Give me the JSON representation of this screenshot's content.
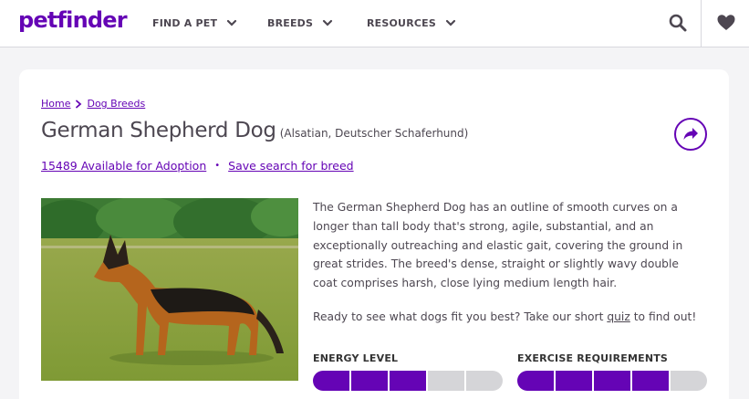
{
  "header": {
    "logo": "petfinder",
    "nav": [
      {
        "label": "FIND A PET"
      },
      {
        "label": "BREEDS"
      },
      {
        "label": "RESOURCES"
      }
    ],
    "icons": [
      "search-icon",
      "heart-icon"
    ]
  },
  "breadcrumb": {
    "home": "Home",
    "dog_breeds": "Dog Breeds"
  },
  "breed": {
    "name": "German Shepherd Dog",
    "aka": "(Alsatian, Deutscher Schaferhund)",
    "available_link": "15489 Available for Adoption",
    "separator": "•",
    "save_search": "Save search for breed",
    "description": "The German Shepherd Dog has an outline of smooth curves on a longer than tall body that's strong, agile, substantial, and an exceptionally outreaching and elastic gait, covering the ground in great strides. The breed's dense, straight or slightly wavy double coat comprises harsh, close lying medium length hair.",
    "ready_prefix": "Ready to see what dogs fit you best? Take our short ",
    "quiz_link": "quiz",
    "ready_suffix": " to find out!"
  },
  "meters": {
    "energy": {
      "label": "ENERGY LEVEL",
      "level": 3,
      "max": 5
    },
    "exercise": {
      "label": "EXERCISE REQUIREMENTS",
      "level": 4,
      "max": 5
    }
  },
  "colors": {
    "brand": "#6504b5",
    "text": "#4d4751",
    "meter_off": "#d5d5d8"
  }
}
